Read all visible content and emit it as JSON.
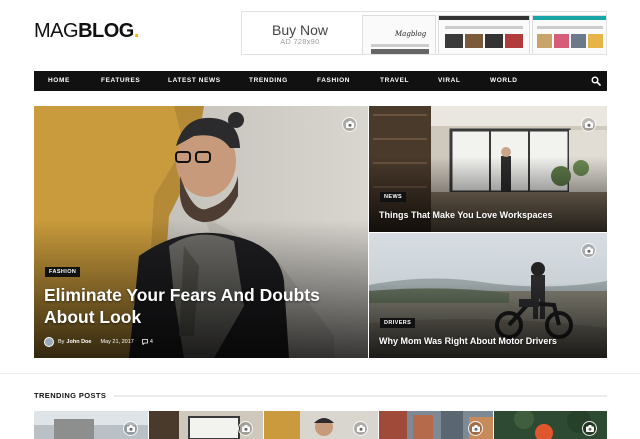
{
  "logo": {
    "part1": "MAG",
    "part2": "BLOG",
    "dot": "."
  },
  "ad": {
    "cta": "Buy Now",
    "size": "AD 728x90",
    "mini_logo": "Magblog"
  },
  "nav": {
    "items": [
      "HOME",
      "FEATURES",
      "LATEST NEWS",
      "TRENDING",
      "FASHION",
      "TRAVEL",
      "VIRAL",
      "WORLD"
    ],
    "search_icon": "search-icon"
  },
  "hero": {
    "main": {
      "tag": "FASHION",
      "title_line1": "Eliminate Your Fears And Doubts",
      "title_line2": "About Look",
      "author_prefix": "By",
      "author": "John Doe",
      "date": "May 21, 2017",
      "comments": "4"
    },
    "side_top": {
      "tag": "NEWS",
      "title": "Things That Make You Love Workspaces"
    },
    "side_bottom": {
      "tag": "DRIVERS",
      "title": "Why Mom Was Right About Motor Drivers"
    }
  },
  "trending": {
    "heading": "TRENDING POSTS"
  },
  "colors": {
    "accent": "#f5b400",
    "nav_bg": "#111111",
    "text": "#222222"
  }
}
